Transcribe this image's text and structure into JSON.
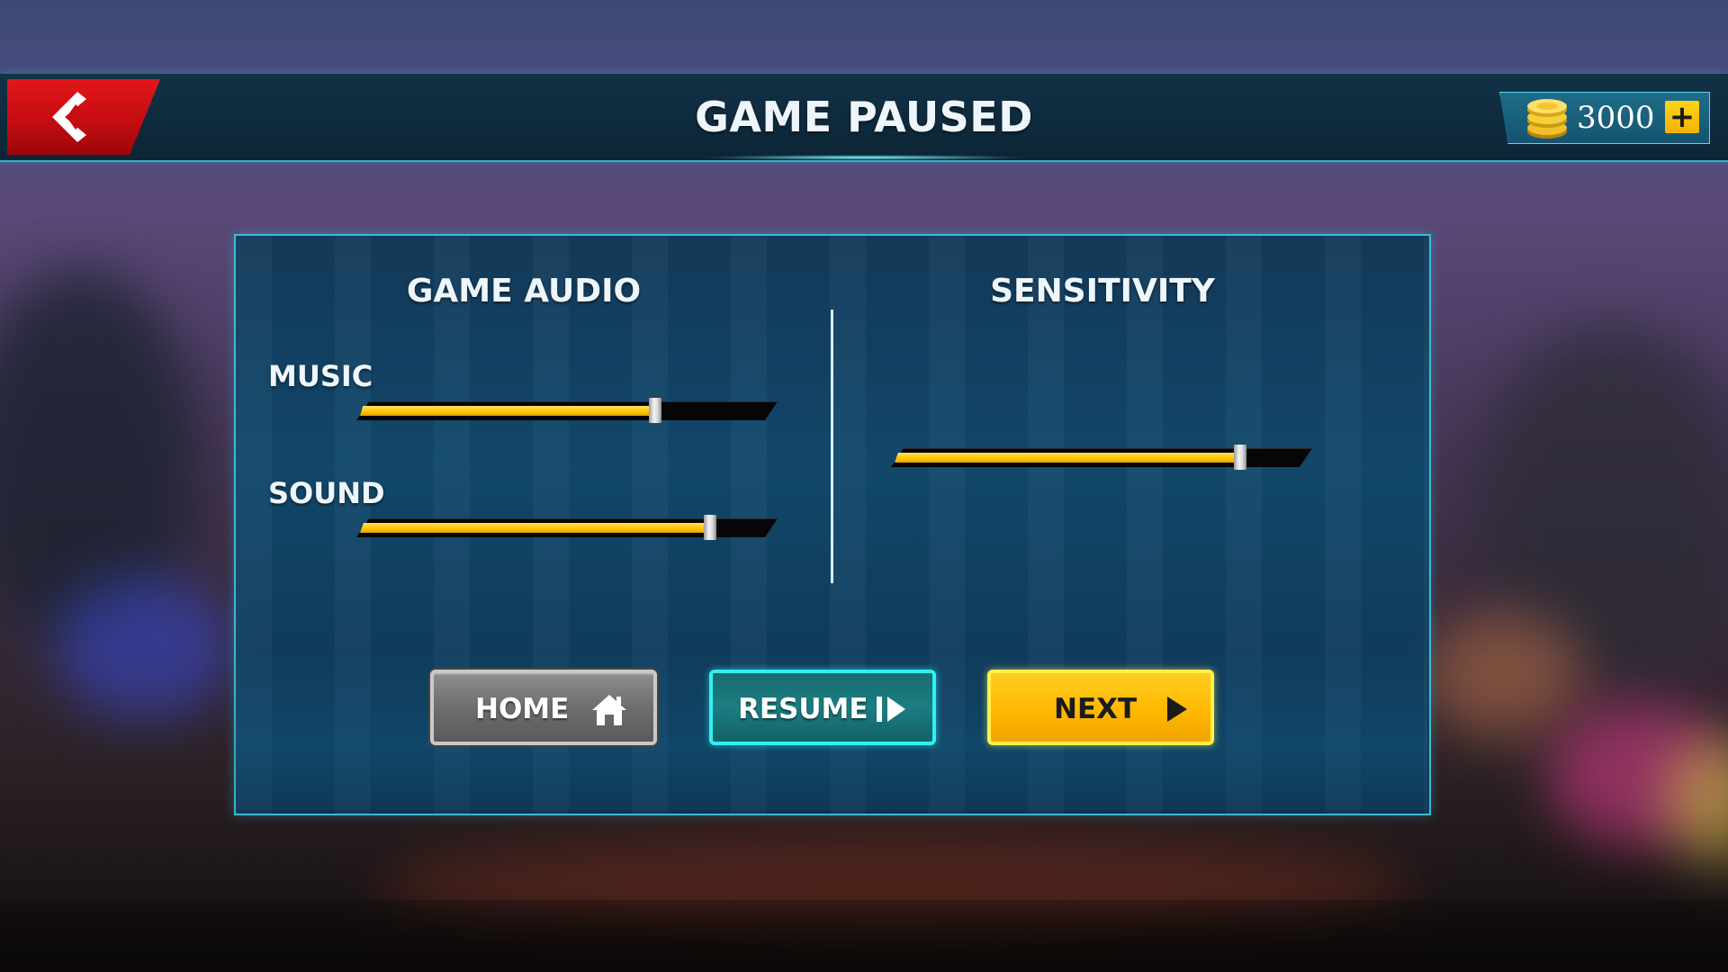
{
  "header": {
    "title": "GAME PAUSED",
    "coins": "3000",
    "add_coins_label": "+"
  },
  "audio": {
    "section_title": "GAME AUDIO",
    "music": {
      "label": "MUSIC",
      "level": 0.71
    },
    "sound": {
      "label": "SOUND",
      "level": 0.84
    }
  },
  "sensitivity": {
    "section_title": "SENSITIVITY",
    "level": 0.83
  },
  "buttons": {
    "home": {
      "label": "HOME",
      "icon": "home-icon"
    },
    "resume": {
      "label": "RESUME",
      "icon": "resume-icon"
    },
    "next": {
      "label": "NEXT",
      "icon": "play-icon"
    }
  },
  "icons": {
    "back": "back-arrow-icon",
    "coin": "coin-stack-icon"
  },
  "colors": {
    "accent_cyan": "#2ff0f3",
    "slider_fill": "#ffc400",
    "back_button": "#d4121a",
    "next_button": "#ffb800"
  }
}
